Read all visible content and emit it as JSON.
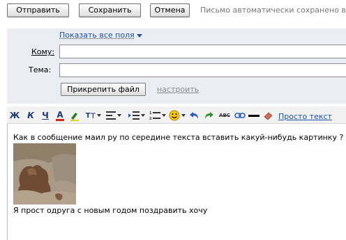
{
  "toolbar_top": {
    "send_label": "Отправить",
    "save_label": "Сохранить",
    "cancel_label": "Отмена",
    "autosave_text": "Письмо автоматически сохранено в"
  },
  "header": {
    "show_all_fields": "Показать все поля",
    "to_label": "Кому:",
    "to_value": "",
    "subject_label": "Тема:",
    "subject_value": "",
    "attach_label": "Прикрепить файл",
    "configure_label": "настроить"
  },
  "format_toolbar": {
    "bold": "Ж",
    "italic": "К",
    "underline": "Ч",
    "text_color": "A",
    "font_size": "т",
    "strikethrough": "ABC",
    "plain_text_link": "Просто текст"
  },
  "body": {
    "line1": "Как в сообщение маил ру по середине текста вставить какуй-нибудь картинку ?",
    "line2": "Я прост одруга с новым годом поздравить хочу"
  }
}
